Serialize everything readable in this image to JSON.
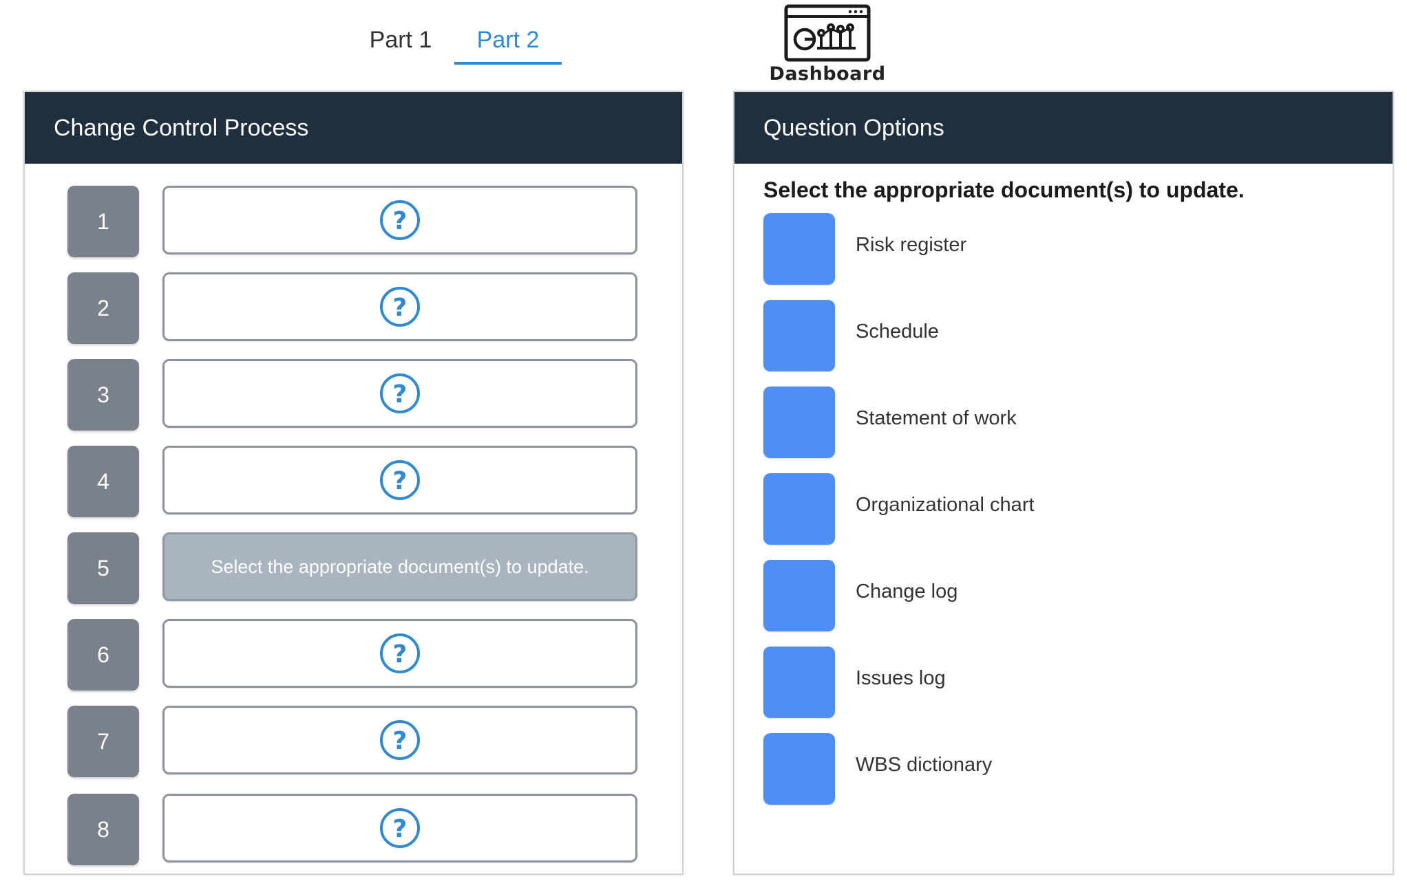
{
  "tabs": [
    {
      "label": "Part 1",
      "active": false
    },
    {
      "label": "Part 2",
      "active": true
    }
  ],
  "dashboard": {
    "label": "Dashboard",
    "icon": "dashboard-icon"
  },
  "left_panel": {
    "title": "Change Control Process",
    "steps": [
      {
        "number": "1",
        "content": "",
        "icon": "question-mark-icon"
      },
      {
        "number": "2",
        "content": "",
        "icon": "question-mark-icon"
      },
      {
        "number": "3",
        "content": "",
        "icon": "question-mark-icon"
      },
      {
        "number": "4",
        "content": "",
        "icon": "question-mark-icon"
      },
      {
        "number": "5",
        "content": "Select the appropriate document(s) to update."
      },
      {
        "number": "6",
        "content": "",
        "icon": "question-mark-icon"
      },
      {
        "number": "7",
        "content": "",
        "icon": "question-mark-icon"
      },
      {
        "number": "8",
        "content": "",
        "icon": "question-mark-icon"
      }
    ]
  },
  "right_panel": {
    "title": "Question Options",
    "question": "Select the appropriate document(s) to update.",
    "options": [
      {
        "label": "Risk register"
      },
      {
        "label": "Schedule"
      },
      {
        "label": "Statement of work"
      },
      {
        "label": "Organizational chart"
      },
      {
        "label": "Change log"
      },
      {
        "label": "Issues log"
      },
      {
        "label": "WBS dictionary"
      }
    ]
  },
  "colors": {
    "header_bg": "#1f2f3d",
    "accent": "#2f8ad1",
    "option_box": "#4f8ff5",
    "step_number_bg": "#7a818b",
    "filled_slot_bg": "#aab4bf",
    "help_icon": "#2f8ad1"
  }
}
